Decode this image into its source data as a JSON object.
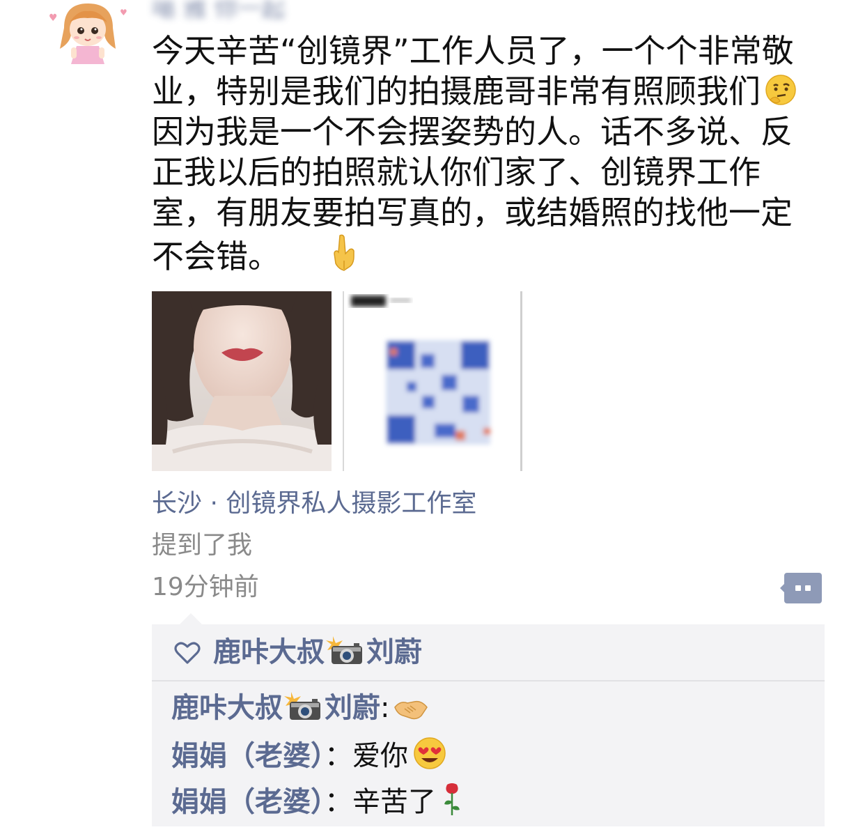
{
  "post": {
    "author_name": "噶 雅 你一起",
    "text_lines": [
      "今天辛苦“创镜界”工作人员了，一个个非常敬",
      "业，特别是我们的拍摄鹿哥非常有照顾我们",
      "因为我是一个不会摆姿势的人。话不多说、反",
      "正我以后的拍照就认你们家了、创镜界工作",
      "室，有朋友要拍写真的，或结婚照的找他一定",
      "不会错。"
    ],
    "emojis": {
      "line2_end": "thinking-face-icon",
      "line6_end": "pointing-down-icon"
    },
    "images": [
      {
        "name": "portrait-photo",
        "alt": "portrait"
      },
      {
        "name": "qr-code-screenshot",
        "alt": "qr"
      }
    ],
    "location": "长沙 · 创镜界私人摄影工作室",
    "mention": "提到了我",
    "time": "19分钟前"
  },
  "interactions": {
    "like_icon": "heart-icon",
    "likes": [
      {
        "name_part1": "鹿咔大叔",
        "name_emoji": "camera-flash-icon",
        "name_part2": "刘蔚"
      }
    ],
    "comments": [
      {
        "author_part1": "鹿咔大叔",
        "author_emoji": "camera-flash-icon",
        "author_part2": "刘蔚",
        "separator": ":",
        "text": "",
        "emoji": "handshake-icon"
      },
      {
        "author": "娟娟（老婆）",
        "separator": "：",
        "text": "爱你",
        "emoji": "heart-eyes-icon"
      },
      {
        "author": "娟娟（老婆）",
        "separator": "：",
        "text": "辛苦了",
        "emoji": "rose-icon"
      }
    ]
  },
  "colors": {
    "link": "#5b6a91",
    "meta": "#8a8a8a",
    "box_bg": "#f3f3f5"
  }
}
